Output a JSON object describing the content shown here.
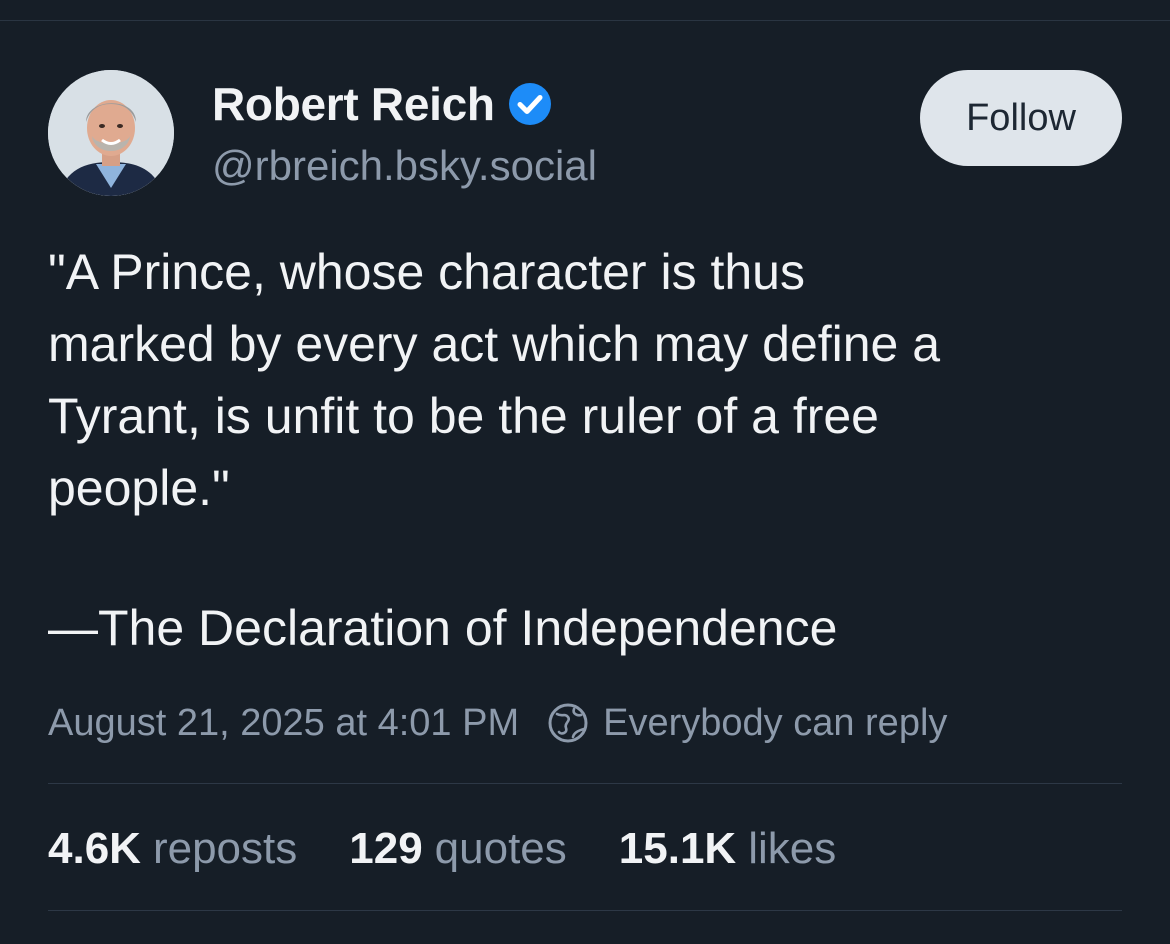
{
  "author": {
    "display_name": "Robert Reich",
    "handle": "@rbreich.bsky.social",
    "verified": true,
    "avatar_icon": "avatar-photo"
  },
  "follow_button": {
    "label": "Follow"
  },
  "post": {
    "quote_lines": [
      "\"A Prince, whose character is thus",
      "marked by every act which may define a",
      "Tyrant, is unfit to be the ruler of a free",
      "people.\""
    ],
    "attribution": "—The Declaration of Independence"
  },
  "meta": {
    "timestamp": "August 21, 2025 at 4:01 PM",
    "reply_setting": "Everybody can reply",
    "reply_icon": "globe-icon"
  },
  "stats": {
    "reposts": {
      "count": "4.6K",
      "label": "reposts"
    },
    "quotes": {
      "count": "129",
      "label": "quotes"
    },
    "likes": {
      "count": "15.1K",
      "label": "likes"
    }
  },
  "colors": {
    "background": "#161e27",
    "text_primary": "#f1f3f5",
    "text_secondary": "#8d9aab",
    "verified_badge": "#1d8cf8",
    "follow_button_bg": "#dfe5eb"
  }
}
